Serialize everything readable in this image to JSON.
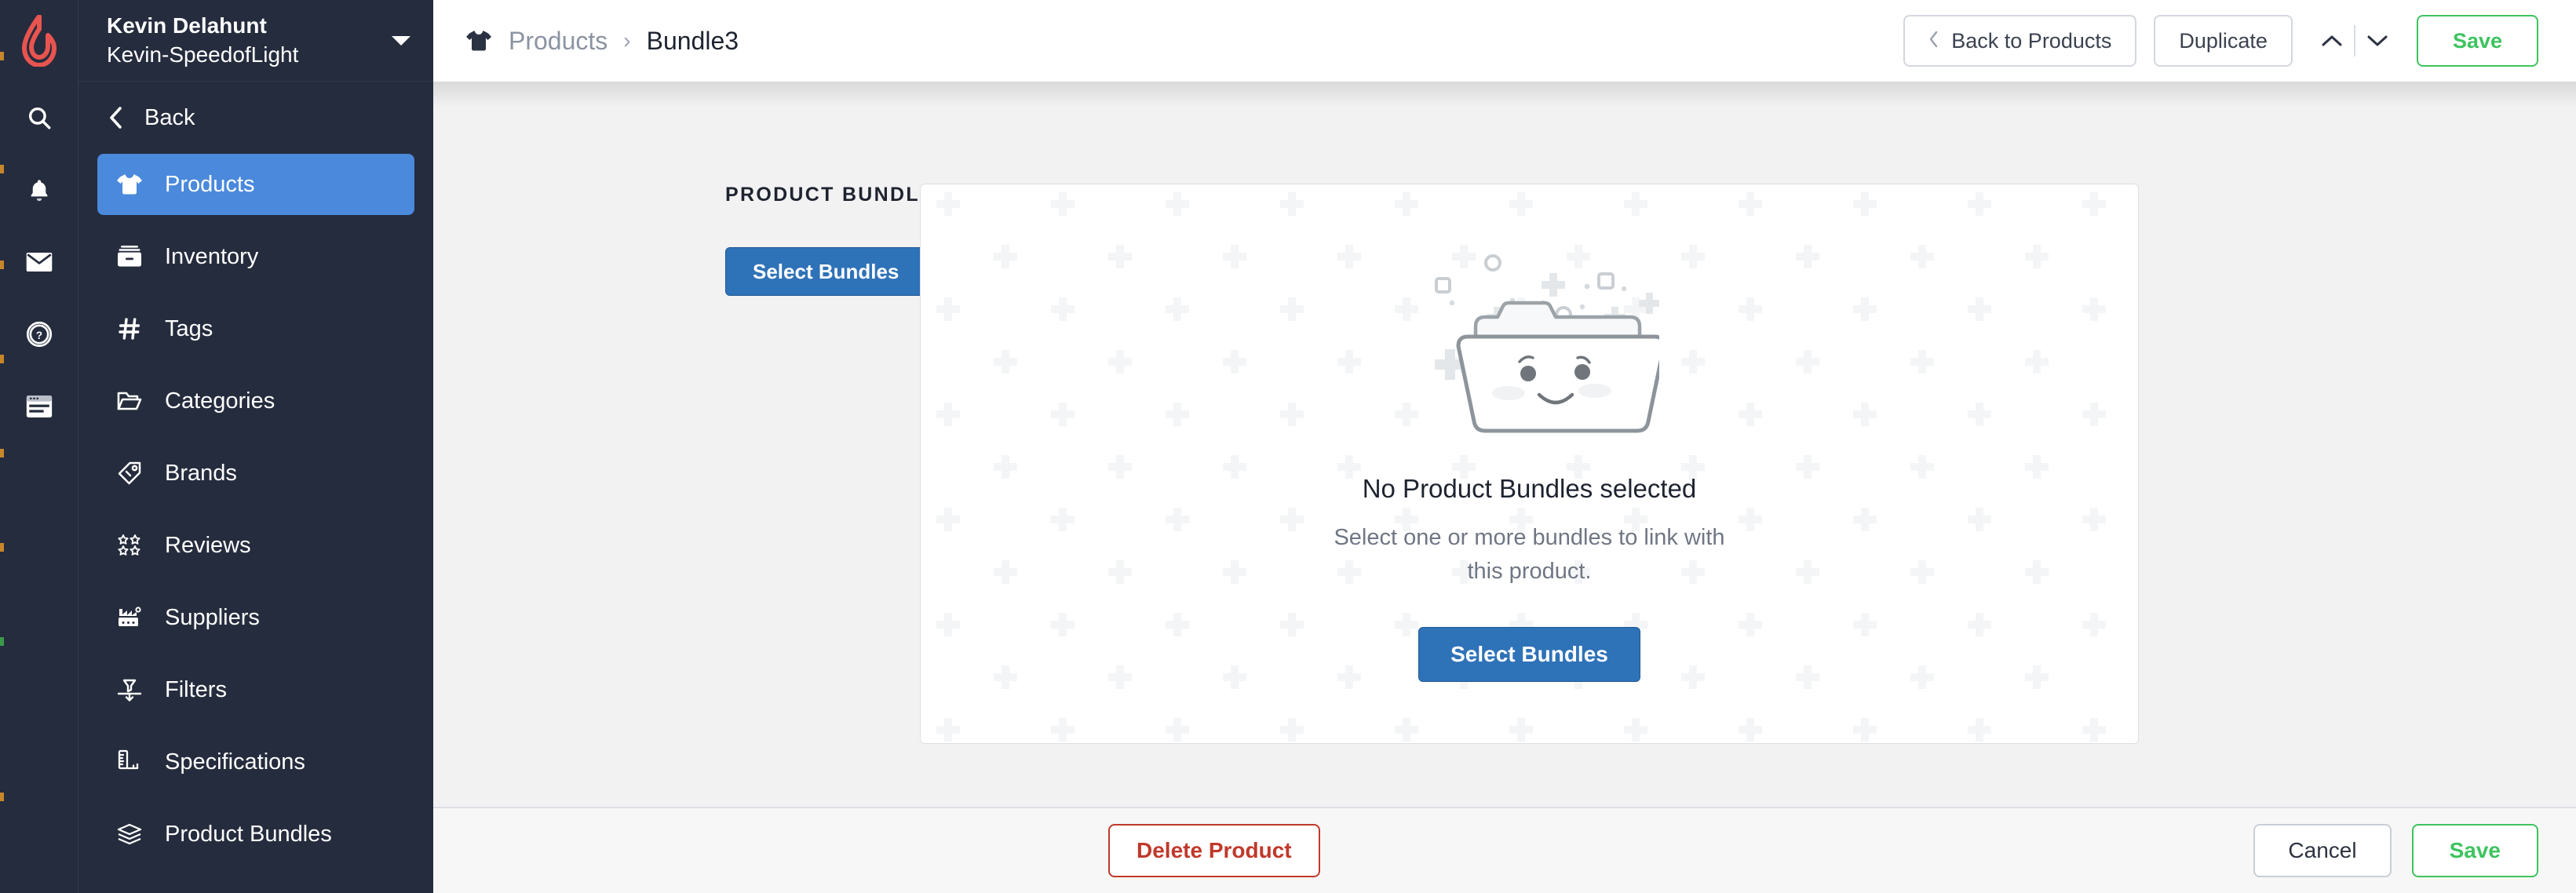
{
  "brand": {
    "logo_color": "#e8544f",
    "logo_name": "lightspeed-flame-logo"
  },
  "account": {
    "name": "Kevin Delahunt",
    "store": "Kevin-SpeedofLight",
    "caret_icon": "chevron-down-icon"
  },
  "rail": {
    "items": [
      {
        "icon": "search-icon",
        "name": "search"
      },
      {
        "icon": "bell-icon",
        "name": "notifications"
      },
      {
        "icon": "mail-icon",
        "name": "messages"
      },
      {
        "icon": "help-circle-icon",
        "name": "help"
      },
      {
        "icon": "register-icon",
        "name": "register"
      }
    ]
  },
  "sidebar": {
    "back_label": "Back",
    "back_icon": "chevron-left-icon",
    "items": [
      {
        "label": "Products",
        "icon": "tshirt-icon",
        "active": true
      },
      {
        "label": "Inventory",
        "icon": "inventory-box-icon",
        "active": false
      },
      {
        "label": "Tags",
        "icon": "hash-icon",
        "active": false
      },
      {
        "label": "Categories",
        "icon": "folder-open-icon",
        "active": false
      },
      {
        "label": "Brands",
        "icon": "price-tag-icon",
        "active": false
      },
      {
        "label": "Reviews",
        "icon": "stars-icon",
        "active": false
      },
      {
        "label": "Suppliers",
        "icon": "factory-icon",
        "active": false
      },
      {
        "label": "Filters",
        "icon": "funnel-icon",
        "active": false
      },
      {
        "label": "Specifications",
        "icon": "ruler-icon",
        "active": false
      },
      {
        "label": "Product Bundles",
        "icon": "layers-icon",
        "active": false
      }
    ],
    "active_bg": "#4a89dc",
    "bg": "#252c3d"
  },
  "topbar": {
    "breadcrumb": {
      "icon": "tshirt-icon",
      "parent": "Products",
      "separator": "›",
      "current": "Bundle3"
    },
    "back_to_products": "Back to Products",
    "back_chevron_icon": "chevron-left-icon",
    "duplicate": "Duplicate",
    "prev_icon": "chevron-up-icon",
    "next_icon": "chevron-down-icon",
    "save": "Save",
    "save_color": "#3ec35f"
  },
  "main": {
    "section_title": "PRODUCT BUNDLES",
    "select_bundles_button": "Select Bundles",
    "blue_button_color": "#2e72b8",
    "empty_state": {
      "illustration": "smiling-folder-illustration",
      "title": "No Product Bundles selected",
      "subtitle": "Select one or more bundles to link with this product.",
      "button": "Select Bundles"
    }
  },
  "footer": {
    "delete_label": "Delete Product",
    "delete_color": "#c0392b",
    "cancel_label": "Cancel",
    "save_label": "Save",
    "save_color": "#3ec35f"
  }
}
